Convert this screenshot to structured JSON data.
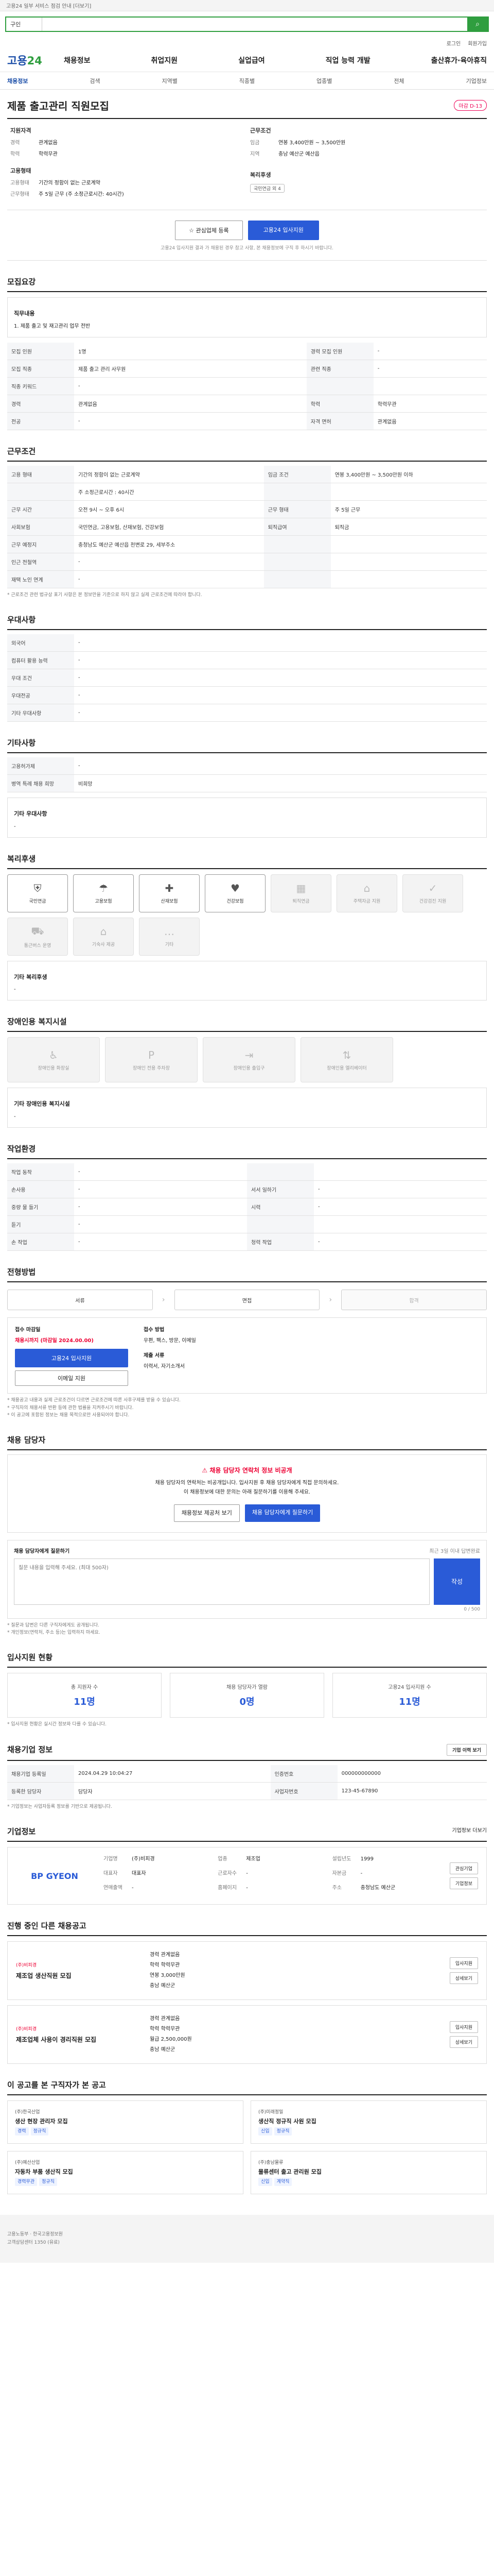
{
  "top_notice": "고용24 일부 서비스 점검 안내 [더보기]",
  "search": {
    "category": "구인",
    "placeholder": "",
    "button_icon": "search-icon"
  },
  "util": [
    "로그인",
    "회원가입"
  ],
  "logo": {
    "a": "고용",
    "b": "24"
  },
  "gnb": [
    "채용정보",
    "취업지원",
    "실업급여",
    "직업 능력 개발",
    "출산휴가·육아휴직"
  ],
  "snb": [
    "채용정보",
    "검색",
    "지역별",
    "직종별",
    "업종별",
    "전체",
    "기업정보"
  ],
  "title": "제품 출고관리 직원모집",
  "dday": "마감 D-13",
  "summary": {
    "c1": {
      "h": "지원자격",
      "rows": [
        [
          "경력",
          "관계없음"
        ],
        [
          "학력",
          "학력무관"
        ]
      ]
    },
    "c1b": {
      "h": "고용형태",
      "rows": [
        [
          "고용형태",
          "기간의 정함이 없는 근로계약"
        ],
        [
          "근무형태",
          "주 5일 근무 (주 소정근로시간: 40시간)"
        ]
      ]
    },
    "c2": {
      "h": "근무조건",
      "rows": [
        [
          "임금",
          "연봉 3,400만원 ~ 3,500만원"
        ],
        [
          "지역",
          "충남 예산군 예산읍"
        ],
        [
          "",
          "충청남도 예산군 예산읍 천변로 29, 세부주소"
        ]
      ]
    },
    "c2b": {
      "h": "복리후생",
      "badge": "국민연금 외 4"
    }
  },
  "actions": {
    "scrap": "관심업체 등록",
    "apply": "고용24 입사지원"
  },
  "action_note": "고용24 입사지원 결과 가 채용된 경우 참고 사항, 본 채용정보에 구직 후 하시기 바랍니다.",
  "s1": {
    "h": "모집요강",
    "sub": "직무내용",
    "duty": "1. 제품 출고 및 재고관리 업무 전반",
    "rows": [
      [
        "모집 인원",
        "1명",
        "경력 모집 인원",
        "-"
      ],
      [
        "모집 직종",
        "제품 출고 관리 사무원",
        "관련 직종",
        "-"
      ],
      [
        "직종 키워드",
        "-",
        "",
        ""
      ],
      [
        "경력",
        "관계없음",
        "학력",
        "학력무관"
      ],
      [
        "전공",
        "-",
        "자격 면허",
        "관계없음"
      ]
    ]
  },
  "s2": {
    "h": "근무조건",
    "rows": [
      [
        "고용 형태",
        "기간의 정함이 없는 근로계약",
        "임금 조건",
        "연봉 3,400만원 ~ 3,500만원 이하"
      ],
      [
        "",
        "주 소정근로시간 : 40시간",
        "",
        ""
      ],
      [
        "근무 시간",
        "오전 9시 ~ 오후 6시",
        "근무 형태",
        "주 5일 근무"
      ],
      [
        "사회보험",
        "국민연금, 고용보험, 산재보험, 건강보험",
        "퇴직급여",
        "퇴직금"
      ],
      [
        "근무 예정지",
        "충청남도 예산군 예산읍 천변로 29, 세부주소",
        "",
        ""
      ],
      [
        "인근 전철역",
        "-",
        "",
        ""
      ],
      [
        "재택 노인 연계",
        "-",
        "",
        ""
      ]
    ],
    "note": "* 근로조건 관련 법규상 표기 사항은 본 정보만을 기준으로 하지 않고 실제 근로조건에 따라야 합니다."
  },
  "s3": {
    "h": "우대사항",
    "rows": [
      [
        "외국어",
        "-"
      ],
      [
        "컴퓨터 활용 능력",
        "-"
      ],
      [
        "우대 조건",
        "-"
      ],
      [
        "우대전공",
        "-"
      ],
      [
        "기타 우대사항",
        "-"
      ]
    ]
  },
  "s4": {
    "h": "기타사항",
    "rows": [
      [
        "고용허가제",
        "-"
      ],
      [
        "병역 특례 채용 희망",
        "비희망"
      ]
    ],
    "memo_h": "기타 우대사항",
    "memo": "-"
  },
  "s5": {
    "h": "복리후생",
    "items": [
      [
        "국민연금",
        true
      ],
      [
        "고용보험",
        true
      ],
      [
        "산재보험",
        true
      ],
      [
        "건강보험",
        true
      ],
      [
        "퇴직연금",
        false
      ],
      [
        "주택자금 지원",
        false
      ],
      [
        "건강검진 지원",
        false
      ],
      [
        "통근버스 운영",
        false
      ],
      [
        "기숙사 제공",
        false
      ],
      [
        "기타",
        false
      ]
    ],
    "memo_h": "기타 복리후생",
    "memo": "-"
  },
  "s6": {
    "h": "장애인용 복지시설",
    "items": [
      "장애인용 화장실",
      "장애인 전용 주차장",
      "장애인용 출입구",
      "장애인용 엘리베이터"
    ],
    "memo_h": "기타 장애인용 복지시설",
    "memo": "-"
  },
  "s7": {
    "h": "작업환경",
    "rows": [
      [
        "작업 동작",
        "-",
        "",
        ""
      ],
      [
        "손사용",
        "-",
        "서서 일하기",
        "-"
      ],
      [
        "중량 물 들기",
        "-",
        "시력",
        "-"
      ],
      [
        "듣기",
        "-",
        "",
        ""
      ],
      [
        "손 작업",
        "-",
        "청력 작업",
        "-"
      ]
    ]
  },
  "s8": {
    "h": "전형방법",
    "steps": [
      "서류",
      "면접",
      "합격"
    ],
    "apply_h": "접수 마감일",
    "deadline": "채용시까지 (마감일 2024.00.00)",
    "apply_btn": "고용24 입사지원",
    "other_btn": "이메일 지원",
    "method_h": "접수 방법",
    "method": "우편, 팩스, 방문, 이메일",
    "doc_h": "제출 서류",
    "doc": "이력서, 자기소개서",
    "notes": [
      "* 채용공고 내용과 실제 근로조건이 다르면 근로조건에 따른 사후구제를 받을 수 있습니다.",
      "* 구직자의 채용서류 반환 등에 관한 법률을 지켜주시기 바랍니다.",
      "* 이 공고에 포함된 정보는 채용 목적으로만 사용되어야 합니다."
    ]
  },
  "s9": {
    "h": "채용 담당자",
    "alert_t": "채용 담당자 연락처 정보 비공개",
    "alert_lines": [
      "채용 담당자의 연락처는 비공개입니다. 입사지원 후 채용 담당자에게 직접 문의하세요.",
      "이 채용정보에 대한 문의는 아래 질문하기를 이용해 주세요."
    ],
    "btn1": "채용정보 제공처 보기",
    "btn2": "채용 담당자에게 질문하기",
    "q_h": "채용 담당자에게 질문하기",
    "q_hint": "최근 3일 이내 답변완료",
    "q_placeholder": "질문 내용을 입력해 주세요. (최대 500자)",
    "q_count": "0 / 500",
    "q_send": "작성",
    "q_notes": [
      "* 질문과 답변은 다른 구직자에게도 공개됩니다.",
      "* 개인정보(연락처, 주소 등)는 입력하지 마세요."
    ]
  },
  "s10": {
    "h": "입사지원 현황",
    "stats": [
      [
        "총 지원자 수",
        "11명"
      ],
      [
        "채용 담당자가 열람",
        "0명"
      ],
      [
        "고용24 입사지원 수",
        "11명"
      ]
    ],
    "note": "* 입사지원 현황은 실시간 정보와 다를 수 있습니다."
  },
  "s11": {
    "h": "채용기업 정보",
    "btn": "기업 이력 보기",
    "rows": [
      [
        "채용기업 등록일",
        "2024.04.29 10:04:27",
        "인증번호",
        "000000000000"
      ],
      [
        "등록한 담당자",
        "담당자",
        "사업자번호",
        "123-45-67890"
      ]
    ],
    "note": "* 기업정보는 사업자등록 정보를 기반으로 제공됩니다."
  },
  "s12": {
    "h": "기업정보",
    "more": "기업정보 더보기",
    "logo": "BP GYEON",
    "info": [
      [
        "기업명",
        "(주)비피경"
      ],
      [
        "업종",
        "제조업"
      ],
      [
        "설립년도",
        "1999"
      ],
      [
        "대표자",
        "대표자"
      ],
      [
        "근로자수",
        "-"
      ],
      [
        "자본금",
        "-"
      ],
      [
        "연매출액",
        "-"
      ],
      [
        "홈페이지",
        "-"
      ],
      [
        "주소",
        "충청남도 예산군"
      ]
    ],
    "btns": [
      "관심기업",
      "기업정보"
    ]
  },
  "s13": {
    "h": "진행 중인 다른 채용공고",
    "jobs": [
      {
        "co": "(주)비피경",
        "t": "제조업 생산직원 모집",
        "m": [
          "경력 관계없음",
          "학력 학력무관",
          "연봉 3,000만원",
          "충남 예산군"
        ],
        "btns": [
          "입사지원",
          "상세보기"
        ]
      },
      {
        "co": "(주)비피경",
        "t": "제조업체 사용이 경리직원 모집",
        "m": [
          "경력 관계없음",
          "학력 학력무관",
          "월급 2,500,000원",
          "충남 예산군"
        ],
        "btns": [
          "입사지원",
          "상세보기"
        ]
      }
    ]
  },
  "s14": {
    "h": "이 공고를 본 구직자가 본 공고",
    "items": [
      {
        "co": "(주)한국산업",
        "t": "생산 현장 관리자 모집",
        "tags": [
          "경력",
          "정규직"
        ]
      },
      {
        "co": "(주)미래정밀",
        "t": "생산직 정규직 사원 모집",
        "tags": [
          "신입",
          "정규직"
        ]
      },
      {
        "co": "(주)예산산업",
        "t": "자동차 부품 생산직 모집",
        "tags": [
          "경력무관",
          "정규직"
        ]
      },
      {
        "co": "(주)충남물류",
        "t": "물류센터 출고 관리원 모집",
        "tags": [
          "신입",
          "계약직"
        ]
      }
    ]
  },
  "footer": [
    "고용노동부 · 한국고용정보원",
    "고객상담센터 1350 (유료)"
  ]
}
